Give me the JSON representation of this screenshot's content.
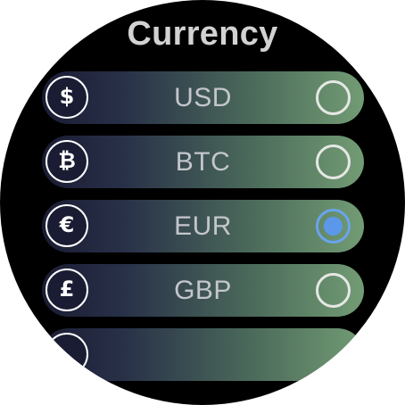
{
  "screen": {
    "title": "Currency"
  },
  "currencies": [
    {
      "code": "USD",
      "symbol": "$",
      "icon": "dollar-coin-icon",
      "selected": false
    },
    {
      "code": "BTC",
      "symbol": "₿",
      "icon": "bitcoin-coin-icon",
      "selected": false
    },
    {
      "code": "EUR",
      "symbol": "€",
      "icon": "euro-coin-icon",
      "selected": true
    },
    {
      "code": "GBP",
      "symbol": "£",
      "icon": "pound-coin-icon",
      "selected": false
    }
  ],
  "colors": {
    "background": "#000000",
    "title": "#d2d2d2",
    "row_gradient_start": "#1a1c33",
    "row_gradient_end": "#729c74",
    "radio_selected": "#5c98ea",
    "radio_unselected": "#e4e8e4"
  }
}
